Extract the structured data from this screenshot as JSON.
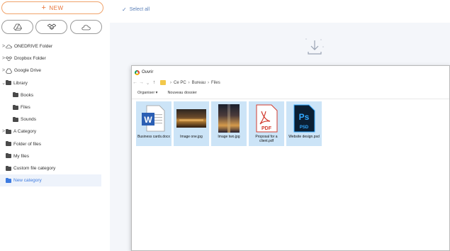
{
  "sidebar": {
    "new_label": "NEW",
    "cloud_buttons": [
      "google-drive-icon",
      "dropbox-icon",
      "onedrive-icon"
    ],
    "tree": [
      {
        "label": "ONEDRIVE Folder",
        "expander": ">",
        "icon": "onedrive-icon",
        "indent": 0
      },
      {
        "label": "Dropbox Folder",
        "expander": ">",
        "icon": "dropbox-icon",
        "indent": 0
      },
      {
        "label": "Google Drive",
        "expander": ">",
        "icon": "google-drive-icon",
        "indent": 0
      },
      {
        "label": "Library",
        "expander": "v",
        "icon": "folder-icon",
        "indent": 0
      },
      {
        "label": "Books",
        "expander": "",
        "icon": "folder-icon",
        "indent": 1
      },
      {
        "label": "Files",
        "expander": "",
        "icon": "folder-icon",
        "indent": 1
      },
      {
        "label": "Sounds",
        "expander": "",
        "icon": "folder-icon",
        "indent": 1
      },
      {
        "label": "A Category",
        "expander": ">",
        "icon": "folder-icon",
        "indent": 0
      },
      {
        "label": "Folder of files",
        "expander": "",
        "icon": "folder-icon",
        "indent": 0
      },
      {
        "label": "My files",
        "expander": "",
        "icon": "folder-icon",
        "indent": 0
      },
      {
        "label": "Custom file category",
        "expander": "",
        "icon": "folder-icon",
        "indent": 0
      },
      {
        "label": "New category",
        "expander": "",
        "icon": "folder-icon",
        "indent": 0,
        "active": true
      }
    ]
  },
  "topbar": {
    "select_all": "Select all"
  },
  "dialog": {
    "title": "Ouvrir",
    "breadcrumb": [
      "Ce PC",
      "Bureau",
      "Files"
    ],
    "toolbar": {
      "organize": "Organiser ▾",
      "new_folder": "Nouveau dossier"
    },
    "files": [
      {
        "name": "Business cards.docx",
        "type": "word-icon"
      },
      {
        "name": "Image one.jpg",
        "type": "photo"
      },
      {
        "name": "Image two.jpg",
        "type": "photo"
      },
      {
        "name": "Proposal for a client.pdf",
        "type": "pdf-icon",
        "icon_text": "PDF"
      },
      {
        "name": "Website design.psd",
        "type": "photoshop-icon",
        "icon_text": "Ps",
        "icon_sub": "PSD"
      }
    ]
  },
  "colors": {
    "accent": "#3d7be0",
    "new_button": "#e8743a",
    "selection": "#cce4f7"
  }
}
